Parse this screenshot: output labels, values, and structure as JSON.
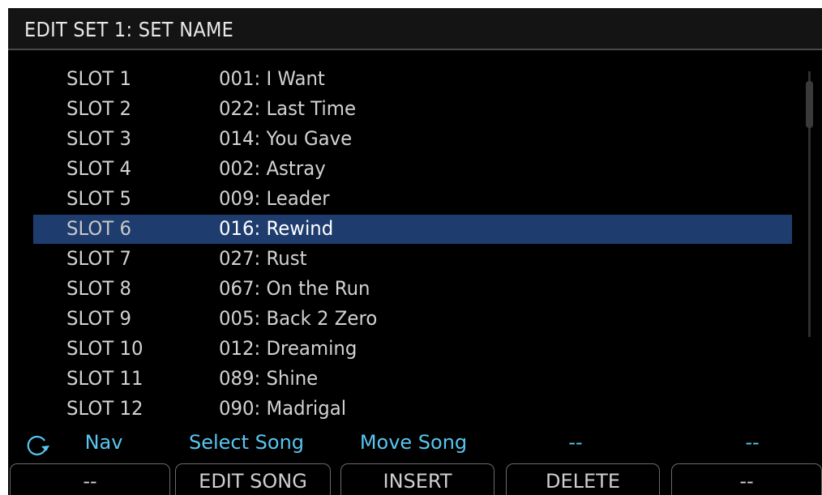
{
  "header": {
    "title": "EDIT SET 1: SET NAME"
  },
  "list": {
    "selected_index": 5,
    "rows": [
      {
        "slot": "SLOT 1",
        "song": "001: I Want"
      },
      {
        "slot": "SLOT 2",
        "song": "022: Last Time"
      },
      {
        "slot": "SLOT 3",
        "song": "014: You Gave"
      },
      {
        "slot": "SLOT 4",
        "song": "002: Astray"
      },
      {
        "slot": "SLOT 5",
        "song": "009: Leader"
      },
      {
        "slot": "SLOT 6",
        "song": "016: Rewind"
      },
      {
        "slot": "SLOT 7",
        "song": "027: Rust"
      },
      {
        "slot": "SLOT 8",
        "song": "067: On the Run"
      },
      {
        "slot": "SLOT 9",
        "song": "005: Back 2 Zero"
      },
      {
        "slot": "SLOT 10",
        "song": "012: Dreaming"
      },
      {
        "slot": "SLOT 11",
        "song": "089: Shine"
      },
      {
        "slot": "SLOT 12",
        "song": "090: Madrigal"
      }
    ]
  },
  "knob_labels": {
    "icon": "rotate-knob-icon",
    "nav": "Nav",
    "select": "Select Song",
    "move": "Move Song",
    "knob4": "--",
    "knob5": "--"
  },
  "buttons": {
    "b1": "--",
    "b2": "EDIT SONG",
    "b3": "INSERT",
    "b4": "DELETE",
    "b5": "--"
  },
  "colors": {
    "background": "#000000",
    "selection": "#1e3c6e",
    "accent": "#58c6f0",
    "text": "#d2d2d2"
  }
}
